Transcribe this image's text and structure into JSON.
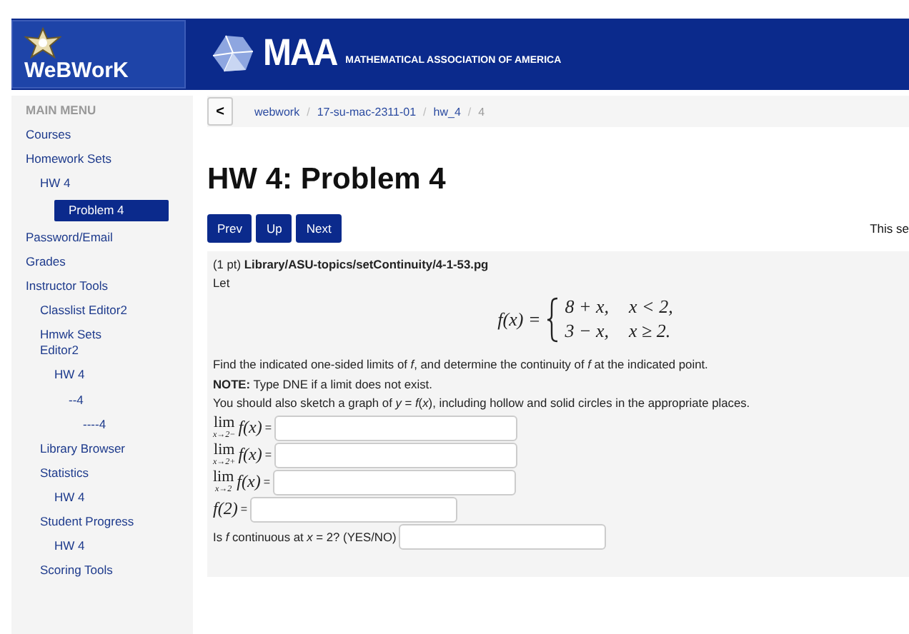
{
  "header": {
    "logo_text": "WeBWorK",
    "brand": "MAA",
    "brand_subtitle": "MATHEMATICAL ASSOCIATION OF AMERICA"
  },
  "sidebar": {
    "heading": "MAIN MENU",
    "items": [
      {
        "label": "Courses",
        "selected": false
      },
      {
        "label": "Homework Sets",
        "selected": false,
        "children": [
          {
            "label": "HW 4",
            "selected": false,
            "children": [
              {
                "label": "Problem 4",
                "selected": true
              }
            ]
          }
        ]
      },
      {
        "label": "Password/Email",
        "selected": false
      },
      {
        "label": "Grades",
        "selected": false
      },
      {
        "label": "Instructor Tools",
        "selected": false,
        "children": [
          {
            "label": "Classlist Editor2",
            "selected": false
          },
          {
            "label": "Hmwk Sets Editor2",
            "selected": false,
            "children": [
              {
                "label": "HW 4",
                "selected": false,
                "children": [
                  {
                    "label": "--4",
                    "selected": false,
                    "children": [
                      {
                        "label": "----4",
                        "selected": false
                      }
                    ]
                  }
                ]
              }
            ]
          },
          {
            "label": "Library Browser",
            "selected": false
          },
          {
            "label": "Statistics",
            "selected": false,
            "children": [
              {
                "label": "HW 4",
                "selected": false
              }
            ]
          },
          {
            "label": "Student Progress",
            "selected": false,
            "children": [
              {
                "label": "HW 4",
                "selected": false
              }
            ]
          },
          {
            "label": "Scoring Tools",
            "selected": false
          }
        ]
      }
    ]
  },
  "breadcrumb": {
    "back": "<",
    "separator": "/",
    "crumbs": [
      {
        "label": "webwork",
        "current": false
      },
      {
        "label": "17-su-mac-2311-01",
        "current": false
      },
      {
        "label": "hw_4",
        "current": false
      },
      {
        "label": "4",
        "current": true
      }
    ]
  },
  "title": "HW 4: Problem 4",
  "nav_buttons": [
    "Prev",
    "Up",
    "Next"
  ],
  "side_note": "This se",
  "problem": {
    "points": "(1 pt)",
    "path": "Library/ASU-topics/setContinuity/4-1-53.pg",
    "intro": "Let",
    "function": {
      "lhs": "f(x) =",
      "cases": [
        {
          "expr": "8 + x,",
          "cond": "x < 2,"
        },
        {
          "expr": "3 − x,",
          "cond": "x ≥ 2."
        }
      ]
    },
    "paragraphs": [
      "Find the indicated one-sided limits of *f*, and determine the continuity of *f* at the indicated point.",
      "**NOTE:** Type DNE if a limit does not exist.",
      "You should also sketch a graph of *y* = *f*(*x*), including hollow and solid circles in the appropriate places."
    ],
    "answers": [
      {
        "kind": "limit",
        "op": "lim",
        "sub": "x→2−",
        "expr": "f(x)",
        "equals": "="
      },
      {
        "kind": "limit",
        "op": "lim",
        "sub": "x→2+",
        "expr": "f(x)",
        "equals": "="
      },
      {
        "kind": "limit",
        "op": "lim",
        "sub": "x→2",
        "expr": "f(x)",
        "equals": "="
      },
      {
        "kind": "value",
        "expr": "f(2)",
        "equals": "="
      },
      {
        "kind": "question",
        "text": "Is *f* continuous at *x* = 2? (YES/NO)"
      }
    ]
  }
}
